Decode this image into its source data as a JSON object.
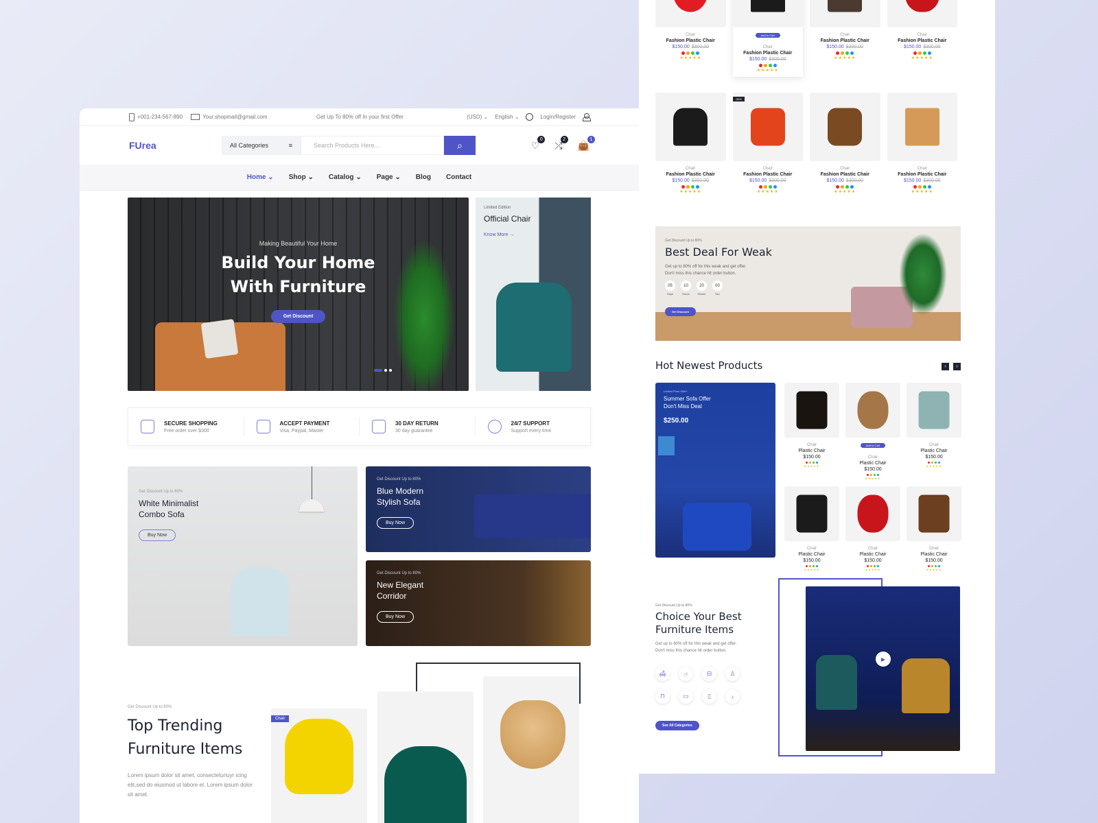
{
  "topbar": {
    "phone": "+001-234-567-890",
    "email": "Your.shopmail@gmail.com",
    "promo": "Get Up To 80% off In your first Offer",
    "currency": "(USD)",
    "language": "English",
    "login": "Login/Register"
  },
  "header": {
    "logo": "FUrea",
    "category_select": "All Categories",
    "search_placeholder": "Search Products Here...",
    "wishlist_count": "0",
    "compare_count": "2",
    "cart_count": "1"
  },
  "nav": {
    "items": [
      {
        "label": "Home",
        "dropdown": true,
        "active": true
      },
      {
        "label": "Shop",
        "dropdown": true
      },
      {
        "label": "Catalog",
        "dropdown": true
      },
      {
        "label": "Page",
        "dropdown": true
      },
      {
        "label": "Blog"
      },
      {
        "label": "Contact"
      }
    ]
  },
  "hero": {
    "subtitle": "Making Beautiful Your Home",
    "title_line1": "Build Your Home",
    "title_line2": "With Furniture",
    "button": "Get Discount",
    "side": {
      "eyebrow": "Limited Edition",
      "title": "Official Chair",
      "link": "Know More →"
    }
  },
  "features": [
    {
      "title": "SECURE SHOPPING",
      "subtitle": "Free order over $300"
    },
    {
      "title": "ACCEPT PAYMENT",
      "subtitle": "Visa, Paypal, Master"
    },
    {
      "title": "30 DAY RETURN",
      "subtitle": "30 day guarantee"
    },
    {
      "title": "24/7 SUPPORT",
      "subtitle": "Support every time"
    }
  ],
  "promos": [
    {
      "eyebrow": "Get Discount Up to 80%",
      "title_line1": "White Minimalist",
      "title_line2": "Combo Sofa",
      "button": "Buy Now"
    },
    {
      "eyebrow": "Get Discount Up to 80%",
      "title_line1": "Blue Modern",
      "title_line2": "Stylish Sofa",
      "button": "Buy Now"
    },
    {
      "eyebrow": "Get Discount Up to 80%",
      "title_line1": "New Elegant",
      "title_line2": "Corridor",
      "button": "Buy Now"
    }
  ],
  "trending": {
    "eyebrow": "Get Discount Up to 80%",
    "title_line1": "Top Trending",
    "title_line2": "Furniture Items",
    "description": "Lorem ipsum dolor sit amet, consecteturiuyr icing elit,sed do eiusmod ut labore et. Lorem ipsum dolor sit amet.",
    "tag": "Chair"
  },
  "products": {
    "category": "Chair",
    "name": "Fashion Plastic Chair",
    "price": "$150.00",
    "old_price": "$300.00",
    "add_to_cart": "Add to Cart",
    "sale_tag": "-30%",
    "colors": [
      "#f0262b",
      "#f5a300",
      "#2ecc40",
      "#1e90ff"
    ],
    "rating": "★★★★★"
  },
  "deal": {
    "eyebrow": "Get Discount Up to 80%",
    "title": "Best Deal For Weak",
    "text_line1": "Get up to 80% off for this weak and get offer.",
    "text_line2": "Don't miss this chance hit order button.",
    "countdown": [
      {
        "value": "05",
        "label": "Days"
      },
      {
        "value": "10",
        "label": "Hours"
      },
      {
        "value": "20",
        "label": "Minute"
      },
      {
        "value": "00",
        "label": "Sec"
      }
    ],
    "button": "Get Discount"
  },
  "hot": {
    "title": "Hot Newest Products",
    "prev": "‹",
    "next": "›",
    "offer": {
      "eyebrow": "Limited Price Offer!",
      "title_line1": "Summer Sofa Offer",
      "title_line2": "Don't Miss Deal",
      "price": "$250.00"
    },
    "item": {
      "category": "Chair",
      "name": "Plastic Chair",
      "price": "$150.00",
      "add_to_cart": "Add to Cart"
    }
  },
  "choice": {
    "eyebrow": "Get Discount Up to 80%",
    "title_line1": "Choice Your Best",
    "title_line2": "Furniture Items",
    "text_line1": "Get up to 80% off for this weak and get offer.",
    "text_line2": "Don't miss this chance hit order button.",
    "category_icons": [
      "sofa-icon",
      "chair-icon",
      "bed-icon",
      "lamp-icon",
      "table-icon",
      "couch-icon",
      "wardrobe-icon",
      "chandelier-icon"
    ],
    "button": "See All Categories"
  },
  "colors": {
    "accent": "#4f55c7",
    "dark": "#1d2233"
  }
}
